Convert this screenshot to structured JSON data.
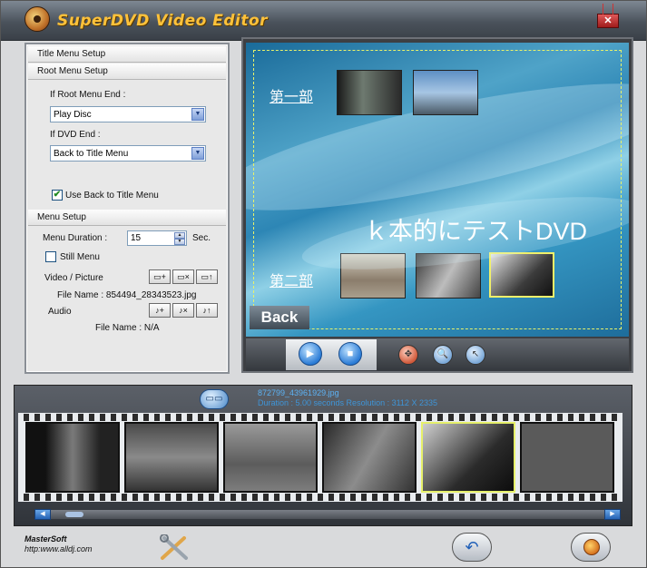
{
  "window": {
    "title": "SuperDVD Video Editor",
    "close_label": "✕"
  },
  "left_panel": {
    "title_menu_setup": "Title Menu Setup",
    "root_menu_setup": "Root Menu Setup",
    "if_root_menu_end_label": "If Root Menu End :",
    "if_root_menu_end_value": "Play Disc",
    "if_dvd_end_label": "If DVD End :",
    "if_dvd_end_value": "Back to Title Menu",
    "use_back_label": "Use Back to Title Menu",
    "use_back_checked": true,
    "menu_setup": "Menu Setup",
    "menu_duration_label": "Menu Duration :",
    "menu_duration_value": "15",
    "menu_duration_unit": "Sec.",
    "still_menu_label": "Still Menu",
    "still_menu_checked": false,
    "video_picture_label": "Video / Picture",
    "video_file_name": "File Name : 854494_28343523.jpg",
    "audio_label": "Audio",
    "audio_file_name": "File Name : N/A",
    "video_btns": [
      "▭+",
      "▭×",
      "▭↑"
    ],
    "audio_btns": [
      "♪+",
      "♪×",
      "♪↑"
    ]
  },
  "preview": {
    "chapter1": "第一部",
    "chapter2": "第二部",
    "disc_title": "ｋ本的にテストDVD",
    "back_label": "Back"
  },
  "controls": {
    "play": "▶",
    "stop": "■",
    "move": "✥",
    "zoom": "🔍",
    "pointer": "↖"
  },
  "timeline": {
    "clip_name": "872799_43961929.jpg",
    "clip_info": "Duration : 5.00 seconds  Resolution : 3112 X 2335",
    "film_btn": "▭▭"
  },
  "footer": {
    "brand": "MasterSoft",
    "url": "http:www.alldj.com",
    "undo": "↶"
  },
  "colors": {
    "accent": "#ffc23a",
    "selection": "#e6f06a",
    "info_text": "#3e95d8"
  }
}
